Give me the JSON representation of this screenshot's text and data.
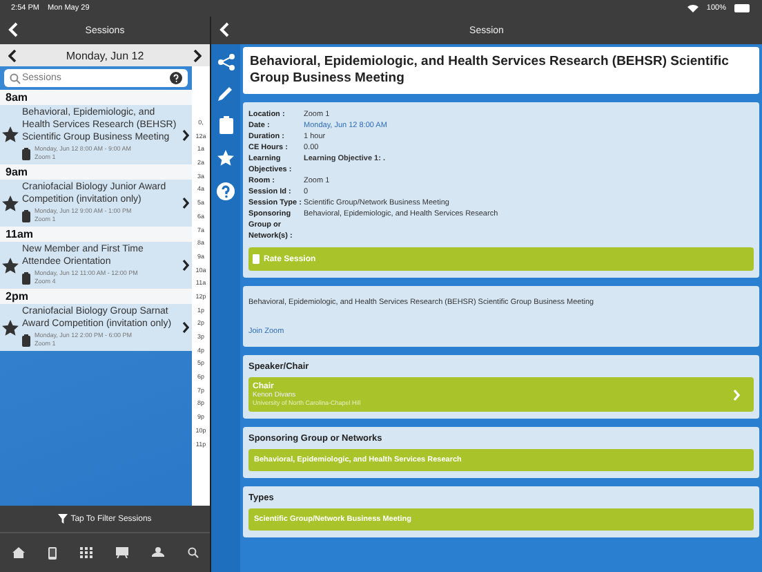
{
  "status_bar": {
    "time": "2:54 PM",
    "date": "Mon May 29",
    "battery": "100%"
  },
  "left_header": {
    "title": "Sessions"
  },
  "date_nav": {
    "label": "Monday, Jun 12"
  },
  "search": {
    "placeholder": "Sessions"
  },
  "groups": [
    {
      "hour": "8am",
      "sessions": [
        {
          "title": "Behavioral, Epidemiologic, and Health Services Research (BEHSR) Scientific Group Business Meeting",
          "time": "Monday, Jun 12 8:00 AM - 9:00 AM",
          "room": "Zoom 1"
        }
      ]
    },
    {
      "hour": "9am",
      "sessions": [
        {
          "title": "Craniofacial Biology Junior Award Competition  (invitation only)",
          "time": "Monday, Jun 12 9:00 AM - 1:00 PM",
          "room": "Zoom 1"
        }
      ]
    },
    {
      "hour": "11am",
      "sessions": [
        {
          "title": "New Member and First Time Attendee Orientation",
          "time": "Monday, Jun 12 11:00 AM - 12:00 PM",
          "room": "Zoom 4"
        }
      ]
    },
    {
      "hour": "2pm",
      "sessions": [
        {
          "title": "Craniofacial Biology Group Sarnat Award Competition  (invitation only)",
          "time": "Monday, Jun 12 2:00 PM - 6:00 PM",
          "room": "Zoom 1"
        }
      ]
    }
  ],
  "hour_index": [
    "0,",
    "12a",
    "1a",
    "2a",
    "3a",
    "4a",
    "5a",
    "6a",
    "7a",
    "8a",
    "9a",
    "10a",
    "11a",
    "12p",
    "1p",
    "2p",
    "3p",
    "4p",
    "5p",
    "6p",
    "7p",
    "8p",
    "9p",
    "10p",
    "11p"
  ],
  "filter_bar": {
    "label": "Tap To Filter Sessions"
  },
  "right_header": {
    "title": "Session"
  },
  "session": {
    "title": "Behavioral, Epidemiologic, and Health Services Research (BEHSR) Scientific Group Business Meeting",
    "details": [
      {
        "label": "Location :",
        "value": "Zoom 1",
        "kind": "plain"
      },
      {
        "label": "Date :",
        "value": "Monday, Jun 12 8:00 AM",
        "kind": "link"
      },
      {
        "label": "Duration :",
        "value": "1 hour",
        "kind": "plain"
      },
      {
        "label": "CE Hours :",
        "value": "0.00",
        "kind": "plain"
      },
      {
        "label": "Learning Objectives :",
        "value": "Learning Objective 1: .",
        "kind": "bold"
      },
      {
        "label": "Room :",
        "value": "Zoom 1",
        "kind": "plain"
      },
      {
        "label": "Session Id :",
        "value": "0",
        "kind": "plain"
      },
      {
        "label": "Session Type :",
        "value": "Scientific Group/Network Business Meeting",
        "kind": "plain"
      },
      {
        "label": "Sponsoring Group or Network(s) :",
        "value": "Behavioral, Epidemiologic, and Health Services Research",
        "kind": "plain"
      }
    ],
    "rate_button": "Rate Session",
    "description": "Behavioral, Epidemiologic, and Health Services Research (BEHSR) Scientific Group Business Meeting",
    "join_link": "Join Zoom",
    "speaker_heading": "Speaker/Chair",
    "speaker": {
      "role": "Chair",
      "name": "Kenon Divans",
      "affiliation": "University of North Carolina-Chapel Hill"
    },
    "sponsor_heading": "Sponsoring Group or Networks",
    "sponsor": "Behavioral, Epidemiologic, and Health Services Research",
    "types_heading": "Types",
    "type": "Scientific Group/Network Business Meeting"
  }
}
